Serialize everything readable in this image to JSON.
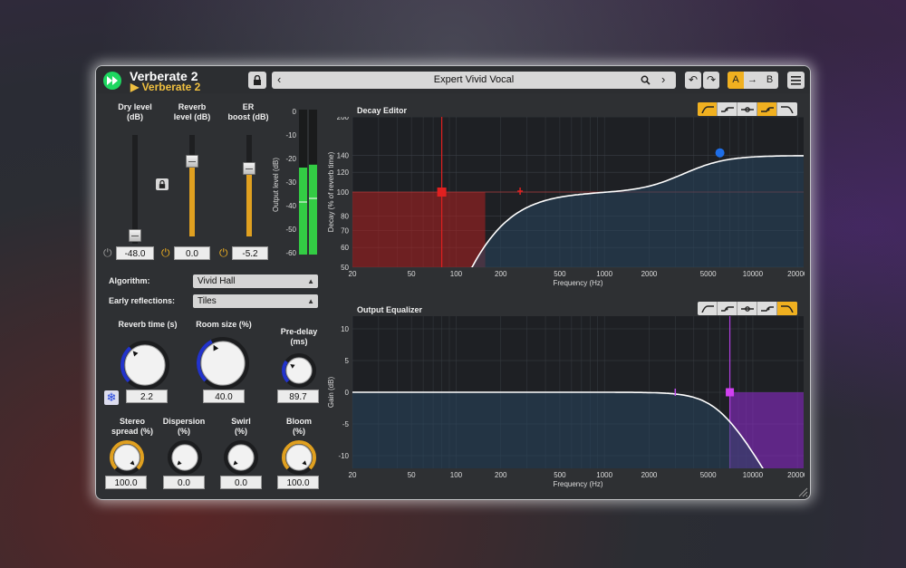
{
  "header": {
    "title": "Verberate 2",
    "preset_sub": "▶ Verberate 2",
    "preset_name": "Expert Vivid Vocal",
    "ab_a": "A",
    "ab_arrow": "→",
    "ab_b": "B"
  },
  "faders": {
    "dry": {
      "label": "Dry level\n(dB)",
      "value": "-48.0",
      "level": 0.0
    },
    "reverb": {
      "label": "Reverb\nlevel (dB)",
      "value": "0.0",
      "level": 0.8
    },
    "er": {
      "label": "ER\nboost (dB)",
      "value": "-5.2",
      "level": 0.62
    }
  },
  "meter": {
    "label": "Output level (dB)",
    "ticks": [
      "0",
      "-10",
      "-20",
      "-30",
      "-40",
      "-50",
      "-60"
    ],
    "left_level": 0.6,
    "right_level": 0.62
  },
  "algorithm": {
    "label": "Algorithm:",
    "value": "Vivid Hall"
  },
  "early_reflections": {
    "label": "Early reflections:",
    "value": "Tiles"
  },
  "knobs_row1": [
    {
      "label": "Reverb time (s)",
      "value": "2.2",
      "fraction": 0.35
    },
    {
      "label": "Room size (%)",
      "value": "40.0",
      "fraction": 0.4
    },
    {
      "label": "Pre-delay\n(ms)",
      "value": "89.7",
      "fraction": 0.3
    }
  ],
  "knobs_row2": [
    {
      "label": "Stereo\nspread (%)",
      "value": "100.0",
      "fraction": 1.0
    },
    {
      "label": "Dispersion\n(%)",
      "value": "0.0",
      "fraction": 0.0
    },
    {
      "label": "Swirl\n(%)",
      "value": "0.0",
      "fraction": 0.0
    },
    {
      "label": "Bloom\n(%)",
      "value": "100.0",
      "fraction": 1.0
    }
  ],
  "decay_editor": {
    "title": "Decay Editor",
    "ylabel": "Decay (% of reverb time)",
    "xlabel": "Frequency (Hz)",
    "yticks": [
      "200",
      "140",
      "120",
      "100",
      "80",
      "70",
      "60",
      "50"
    ],
    "xticks": [
      "20",
      "50",
      "100",
      "200",
      "500",
      "1000",
      "2000",
      "5000",
      "10000",
      "20000"
    ],
    "low_cut_hz": 80,
    "low_cut_pct": 100,
    "high_shelf_hz": 6000,
    "high_shelf_pct": 140
  },
  "output_eq": {
    "title": "Output Equalizer",
    "ylabel": "Gain (dB)",
    "xlabel": "Frequency (Hz)",
    "yticks": [
      "10",
      "5",
      "0",
      "-5",
      "-10"
    ],
    "xticks": [
      "20",
      "50",
      "100",
      "200",
      "500",
      "1000",
      "2000",
      "5000",
      "10000",
      "20000"
    ],
    "high_cut_hz": 7000,
    "high_cut_db": 0
  },
  "colors": {
    "accent": "#f0b020",
    "knob_arc_blue": "#2233cc",
    "knob_arc_orange": "#e0a020",
    "decay_red": "#b02020",
    "eq_purple": "#8a2bc8",
    "meter_green": "#33cc44"
  }
}
